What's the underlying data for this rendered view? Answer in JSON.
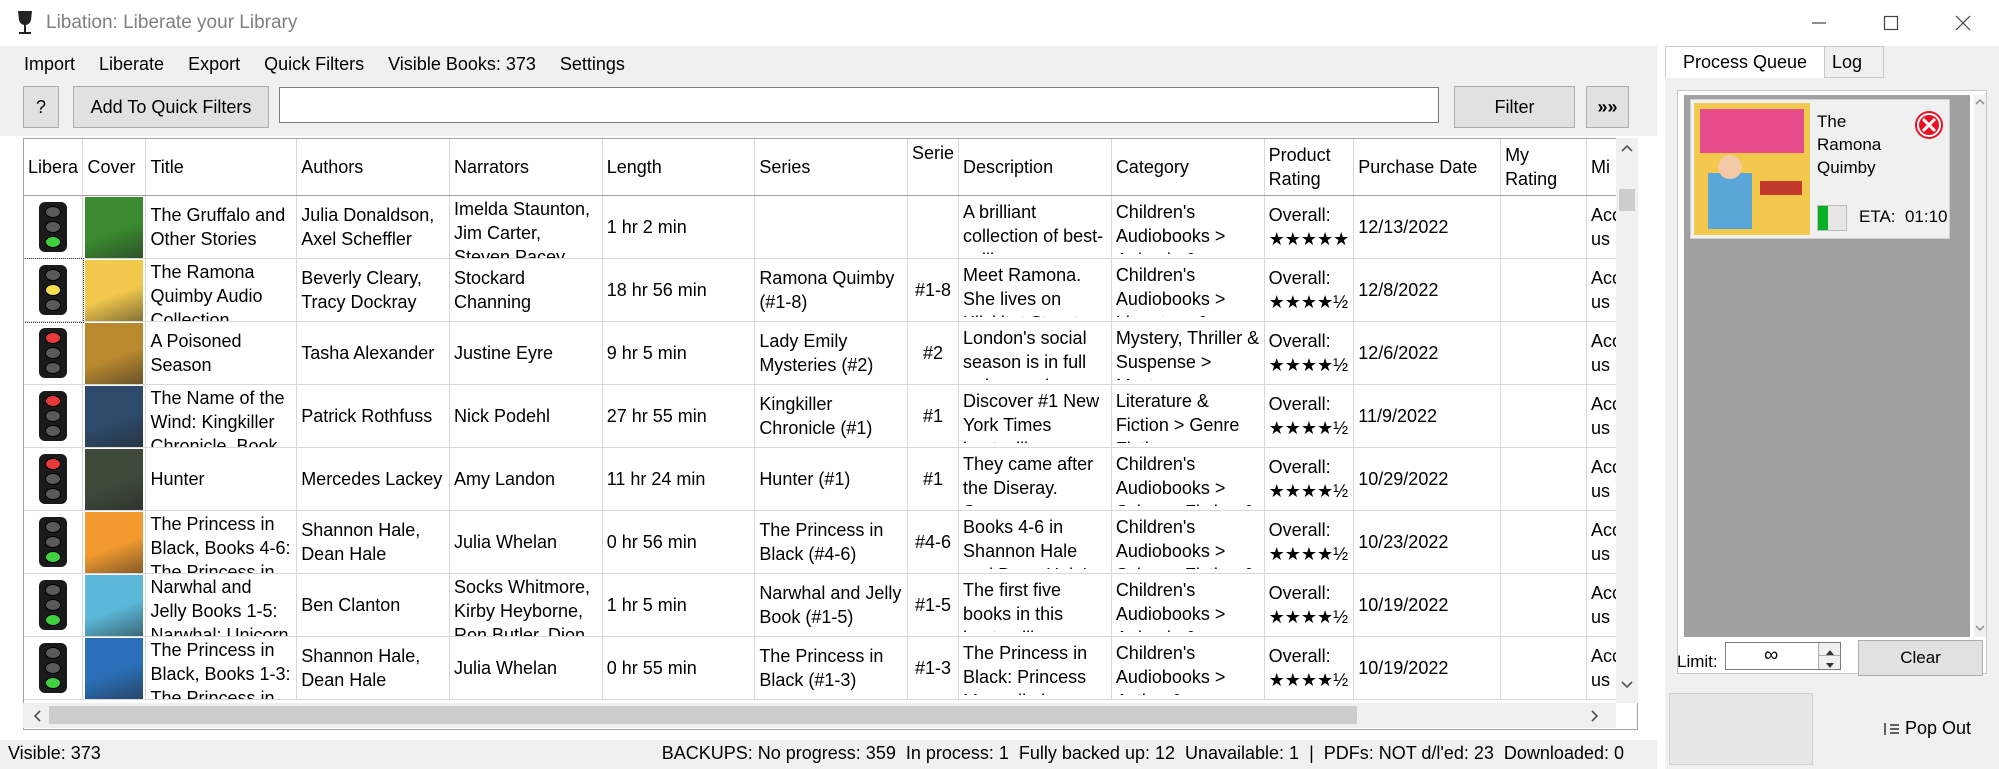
{
  "window": {
    "title": "Libation: Liberate your Library",
    "minimize_label": "—",
    "maximize_label": "☐",
    "close_label": "✕"
  },
  "menu": {
    "import": "Import",
    "liberate": "Liberate",
    "export": "Export",
    "quick_filters": "Quick Filters",
    "visible_books": "Visible Books: 373",
    "settings": "Settings"
  },
  "toolbar": {
    "help_label": "?",
    "add_quick_filters_label": "Add To Quick Filters",
    "search_value": "",
    "filter_label": "Filter",
    "expand_label": "»»"
  },
  "grid": {
    "columns": [
      "Libera",
      "Cover",
      "Title",
      "Authors",
      "Narrators",
      "Length",
      "Series",
      "Serie",
      "Description",
      "Category",
      "Product Rating",
      "Purchase Date",
      "My Rating",
      "Mi"
    ],
    "rows": [
      {
        "status": "green",
        "cover_color": "#3a8a2f",
        "title": "The Gruffalo and Other Stories",
        "authors": "Julia Donaldson, Axel Scheffler",
        "narrators": "Imelda Staunton, Jim Carter, Steven Pacey",
        "length": "1 hr 2 min",
        "series": "",
        "series_order": "",
        "description": "A brilliant collection of best-selling",
        "category": "Children's Audiobooks > Animals &",
        "rating": "Overall: ★★★★★",
        "purchase_date": "12/13/2022",
        "my_rating": "",
        "misc": "Acc us"
      },
      {
        "status": "yellow",
        "cover_color": "#f2c94c",
        "title": "The Ramona Quimby Audio Collection",
        "authors": "Beverly Cleary, Tracy Dockray",
        "narrators": "Stockard Channing",
        "length": "18 hr 56 min",
        "series": "Ramona Quimby (#1-8)",
        "series_order": "#1-8",
        "description": "Meet Ramona. She lives on Klickitat Street",
        "category": "Children's Audiobooks > Literature &",
        "rating": "Overall: ★★★★½",
        "purchase_date": "12/8/2022",
        "my_rating": "",
        "misc": "Acc us"
      },
      {
        "status": "red",
        "cover_color": "#b8892f",
        "title": "A Poisoned Season",
        "authors": "Tasha Alexander",
        "narrators": "Justine Eyre",
        "length": "9 hr 5 min",
        "series": "Lady Emily Mysteries (#2)",
        "series_order": "#2",
        "description": "London's social season is in full swing, and",
        "category": "Mystery, Thriller & Suspense > Mystery",
        "rating": "Overall: ★★★★½",
        "purchase_date": "12/6/2022",
        "my_rating": "",
        "misc": "Acc us"
      },
      {
        "status": "red",
        "cover_color": "#2e4a6b",
        "title": "The Name of the Wind: Kingkiller Chronicle, Book",
        "authors": "Patrick Rothfuss",
        "narrators": "Nick Podehl",
        "length": "27 hr 55 min",
        "series": "Kingkiller Chronicle (#1)",
        "series_order": "#1",
        "description": "Discover #1 New York Times bestselling",
        "category": "Literature & Fiction > Genre Fiction",
        "rating": "Overall: ★★★★½",
        "purchase_date": "11/9/2022",
        "my_rating": "",
        "misc": "Acc us"
      },
      {
        "status": "red",
        "cover_color": "#3d4a3a",
        "title": "Hunter",
        "authors": "Mercedes Lackey",
        "narrators": "Amy Landon",
        "length": "11 hr 24 min",
        "series": "Hunter (#1)",
        "series_order": "#1",
        "description": "They came after the Diseray. Some were",
        "category": "Children's Audiobooks > Science Fiction &",
        "rating": "Overall: ★★★★½",
        "purchase_date": "10/29/2022",
        "my_rating": "",
        "misc": "Acc us"
      },
      {
        "status": "green",
        "cover_color": "#f29a2e",
        "title": "The Princess in Black, Books 4-6: The Princess in",
        "authors": "Shannon Hale, Dean Hale",
        "narrators": "Julia Whelan",
        "length": "0 hr 56 min",
        "series": "The Princess in Black (#4-6)",
        "series_order": "#4-6",
        "description": "Books 4-6 in Shannon Hale and Dean Hale's",
        "category": "Children's Audiobooks > Science Fiction &",
        "rating": "Overall: ★★★★½",
        "purchase_date": "10/23/2022",
        "my_rating": "",
        "misc": "Acc us"
      },
      {
        "status": "green",
        "cover_color": "#5bb8d8",
        "title": "Narwhal and Jelly Books 1-5: Narwhal: Unicorn",
        "authors": "Ben Clanton",
        "narrators": "Socks Whitmore, Kirby Heyborne, Ron Butler, Dion",
        "length": "1 hr 5 min",
        "series": "Narwhal and Jelly Book (#1-5)",
        "series_order": "#1-5",
        "description": "The first five books in this best-selling",
        "category": "Children's Audiobooks > Animals &",
        "rating": "Overall: ★★★★½",
        "purchase_date": "10/19/2022",
        "my_rating": "",
        "misc": "Acc us"
      },
      {
        "status": "green",
        "cover_color": "#2a6fb8",
        "title": "The Princess in Black, Books 1-3: The Princess in",
        "authors": "Shannon Hale, Dean Hale",
        "narrators": "Julia Whelan",
        "length": "0 hr 55 min",
        "series": "The Princess in Black (#1-3)",
        "series_order": "#1-3",
        "description": "The Princess in Black: Princess Magnolia is",
        "category": "Children's Audiobooks > Action &",
        "rating": "Overall: ★★★★½",
        "purchase_date": "10/19/2022",
        "my_rating": "",
        "misc": "Acc us"
      }
    ]
  },
  "status": {
    "visible": "Visible: 373",
    "backups": "BACKUPS: No progress: 359  In process: 1  Fully backed up: 12  Unavailable: 1  |  PDFs: NOT d/l'ed: 23  Downloaded: 0"
  },
  "right_panel": {
    "tab_queue": "Process Queue",
    "tab_log": "Log",
    "queue_item": {
      "title": "The Ramona Quimby",
      "eta": "ETA:  01:10",
      "cover_color": "#f2c94c"
    },
    "limit_label": "Limit:",
    "limit_value": "∞",
    "clear_label": "Clear",
    "pop_out_label": "Pop Out"
  },
  "colors": {
    "accent": "#0078d7",
    "bg": "#f0f0f0",
    "cancel": "#e81123",
    "progress": "#06b025"
  }
}
